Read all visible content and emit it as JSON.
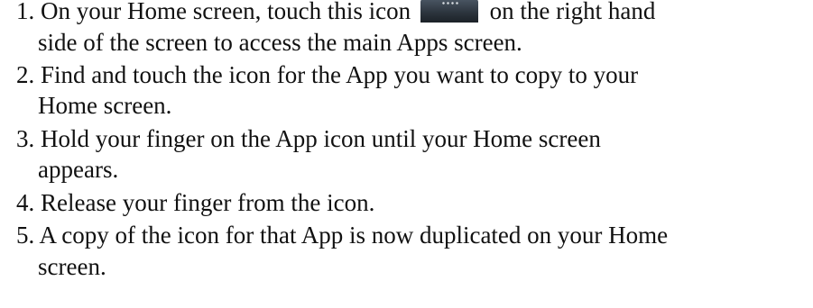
{
  "steps": [
    {
      "number": "1.",
      "line1_before_icon": "On your Home screen, touch this icon",
      "line1_after_icon": "on the right hand",
      "line2": "side of the screen to access the main Apps screen."
    },
    {
      "number": "2.",
      "line1": "Find and touch the icon for the App you want to copy to your",
      "line2": "Home screen."
    },
    {
      "number": "3.",
      "line1": "Hold your finger on the App icon until your Home screen",
      "line2": "appears."
    },
    {
      "number": "4.",
      "line1": "Release your finger from the icon."
    },
    {
      "number": "5.",
      "line1": "A copy of the icon for that App is now duplicated on your Home",
      "line2": "screen."
    }
  ],
  "icons": {
    "apps_icon": "apps-grid-icon"
  }
}
